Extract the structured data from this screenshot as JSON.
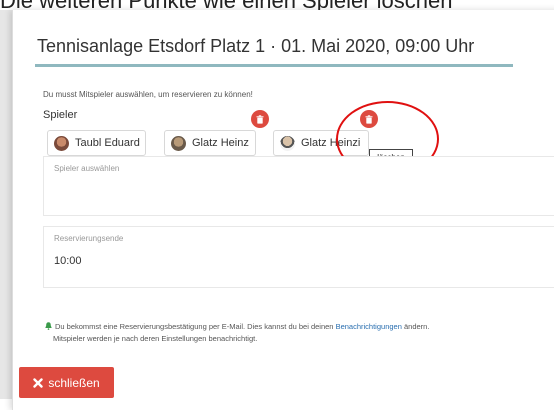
{
  "caption": "Die weiteren Punkte wie einen Spieler löschen",
  "modal": {
    "title": "Tennisanlage Etsdorf Platz 1 · 01. Mai 2020, 09:00 Uhr",
    "hint": "Du musst Mitspieler auswählen, um reservieren zu können!",
    "players_label": "Spieler",
    "players": [
      {
        "name": "Taubl Eduard"
      },
      {
        "name": "Glatz Heinz"
      },
      {
        "name": "Glatz Heinzi"
      }
    ],
    "delete_tooltip": "löschen",
    "select_player": {
      "label": "Spieler auswählen",
      "value": ""
    },
    "reservation_end": {
      "label": "Reservierungsende",
      "value": "10:00"
    },
    "info": {
      "text_before": "Du bekommst eine Reservierungsbestätigung per E-Mail. Dies kannst du bei deinen ",
      "link": "Benachrichtigungen",
      "text_after": " ändern.",
      "line2": "Mitspieler werden je nach deren Einstellungen benachrichtigt."
    },
    "close_label": "schließen"
  },
  "colors": {
    "accent_red": "#dd4a3f",
    "title_rule": "#8fb8bf",
    "link": "#2a6fb0",
    "annotation": "#e01010"
  }
}
